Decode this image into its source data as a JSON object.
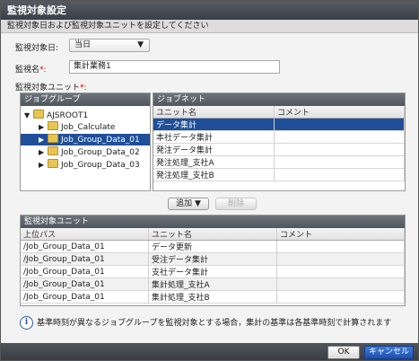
{
  "window": {
    "title": "監視対象設定"
  },
  "description": "監視対象日および監視対象ユニットを設定してください",
  "form": {
    "date_label": "監視対象日:",
    "date_value": "当日",
    "name_label": "監視名",
    "name_required": "*:",
    "name_value": "集計業務1",
    "unit_label": "監視対象ユニット",
    "unit_required": "*:"
  },
  "jobgroup_panel": {
    "header": "ジョブグループ",
    "tree": [
      {
        "label": "AJSROOT1"
      },
      {
        "label": "Job_Calculate"
      },
      {
        "label": "Job_Group_Data_01"
      },
      {
        "label": "Job_Group_Data_02"
      },
      {
        "label": "Job_Group_Data_03"
      }
    ]
  },
  "jobnet_panel": {
    "header": "ジョブネット",
    "columns": [
      "ユニット名",
      "コメント"
    ],
    "rows": [
      "データ集計",
      "本社データ集計",
      "発注データ集計",
      "発注処理_支社A",
      "発注処理_支社B"
    ]
  },
  "buttons": {
    "add": "追加",
    "delete": "削除",
    "ok": "OK",
    "cancel": "キャンセル"
  },
  "monitored_panel": {
    "header": "監視対象ユニット",
    "columns": [
      "上位パス",
      "ユニット名",
      "コメント"
    ],
    "rows": [
      {
        "path": "/Job_Group_Data_01",
        "unit": "データ更新"
      },
      {
        "path": "/Job_Group_Data_01",
        "unit": "受注データ集計"
      },
      {
        "path": "/Job_Group_Data_01",
        "unit": "支社データ集計"
      },
      {
        "path": "/Job_Group_Data_01",
        "unit": "集計処理_支社A"
      },
      {
        "path": "/Job_Group_Data_01",
        "unit": "集計処理_支社B"
      }
    ]
  },
  "info_message": "基準時刻が異なるジョブグループを監視対象とする場合，集計の基準は各基準時刻で計算されます",
  "colors": {
    "selection": "#1f4f99",
    "required": "#dd0000"
  }
}
